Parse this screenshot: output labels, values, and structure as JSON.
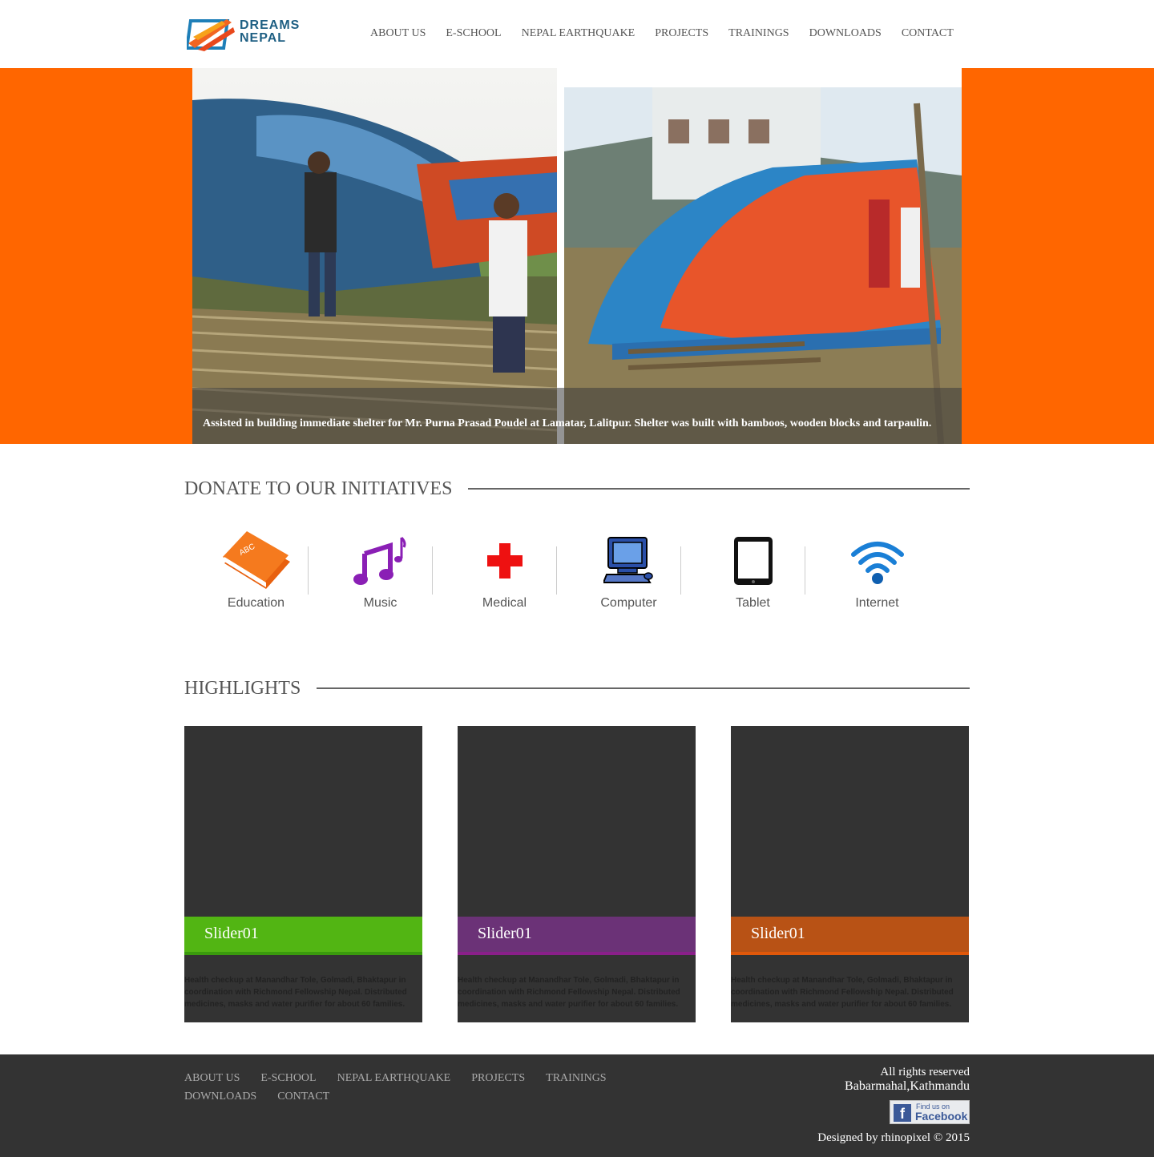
{
  "header": {
    "logo_line1": "DREAMS",
    "logo_line2": "NEPAL",
    "nav": [
      "ABOUT US",
      "E-SCHOOL",
      "NEPAL EARTHQUAKE",
      "PROJECTS",
      "TRAININGS",
      "DOWNLOADS",
      "CONTACT"
    ]
  },
  "hero": {
    "caption": "Assisted in building immediate shelter for Mr. Purna Prasad Poudel at Lamatar, Lalitpur. Shelter was built with bamboos, wooden blocks and tarpaulin."
  },
  "donate": {
    "title": "DONATE TO OUR INITIATIVES",
    "items": [
      {
        "label": "Education",
        "icon": "book-icon"
      },
      {
        "label": "Music",
        "icon": "music-note-icon"
      },
      {
        "label": "Medical",
        "icon": "medical-cross-icon"
      },
      {
        "label": "Computer",
        "icon": "computer-icon"
      },
      {
        "label": "Tablet",
        "icon": "tablet-icon"
      },
      {
        "label": "Internet",
        "icon": "wifi-icon"
      }
    ]
  },
  "highlights": {
    "title": "HIGHLIGHTS",
    "cards": [
      {
        "title": "Slider01",
        "text": "Health checkup at Manandhar Tole, Golmadi, Bhaktapur in coordination with Richmond Fellowship Nepal. Distributed medicines, masks and water purifier for about 60 families.",
        "color": "#52b513",
        "border": "#3a9a0d"
      },
      {
        "title": "Slider01",
        "text": "Health checkup at Manandhar Tole, Golmadi, Bhaktapur in coordination with Richmond Fellowship Nepal. Distributed medicines, masks and water purifier for about 60 families.",
        "color": "#6b3277",
        "border": "#8a1f8a"
      },
      {
        "title": "Slider01",
        "text": "Health checkup at Manandhar Tole, Golmadi, Bhaktapur in coordination with Richmond Fellowship Nepal. Distributed medicines, masks and water purifier for about 60 families.",
        "color": "#b85215",
        "border": "#e0580a"
      }
    ]
  },
  "footer": {
    "nav": [
      "ABOUT US",
      "E-SCHOOL",
      "NEPAL EARTHQUAKE",
      "PROJECTS",
      "TRAININGS",
      "DOWNLOADS",
      "CONTACT"
    ],
    "rights": "All rights reserved",
    "address": "Babarmahal,Kathmandu",
    "facebook_small": "Find us on",
    "facebook_big": "Facebook",
    "designed": "Designed by rhinopixel © 2015"
  },
  "colors": {
    "brand_orange": "#ff6600",
    "dark": "#333333"
  }
}
